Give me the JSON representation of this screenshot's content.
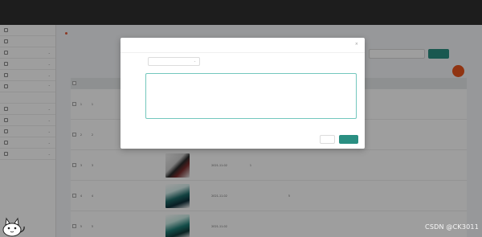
{
  "header": {
    "title": "",
    "user_links": [
      "",
      "",
      ""
    ]
  },
  "sidebar": {
    "items": [
      {
        "label": "",
        "expand": false
      },
      {
        "label": "",
        "expand": false
      },
      {
        "label": "",
        "expand": true
      },
      {
        "label": "",
        "expand": true
      },
      {
        "label": "",
        "expand": true
      },
      {
        "label": "",
        "expand": true
      },
      {
        "label": "",
        "expand": false,
        "sub": true
      },
      {
        "label": "",
        "expand": true
      },
      {
        "label": "",
        "expand": true
      },
      {
        "label": "",
        "expand": true
      },
      {
        "label": "",
        "expand": true
      },
      {
        "label": "",
        "expand": true
      }
    ]
  },
  "breadcrumb": {
    "home": "",
    "current": ""
  },
  "search": {
    "label": "",
    "placeholder": "",
    "button": ""
  },
  "table": {
    "headers": [
      "",
      "",
      "",
      "",
      "",
      "",
      "",
      "",
      "",
      "",
      "",
      "",
      "",
      "",
      ""
    ],
    "rows": [
      {
        "idx": "1",
        "no": "1",
        "c1": "",
        "c2": "",
        "c3": "",
        "thumb": "none",
        "date": "",
        "n1": "",
        "n2": "",
        "n3": "",
        "n4": "",
        "status": "",
        "review": "",
        "actions": [
          "",
          "",
          "",
          ""
        ]
      },
      {
        "idx": "2",
        "no": "2",
        "c1": "",
        "c2": "",
        "c3": "",
        "thumb": "none",
        "date": "",
        "n1": "",
        "n2": "",
        "n3": "",
        "n4": "",
        "status": "",
        "review": "",
        "actions": [
          "",
          "",
          "",
          ""
        ]
      },
      {
        "idx": "3",
        "no": "3",
        "c1": "",
        "c2": "",
        "c3": "",
        "thumb": "a",
        "date": "2021-11-02",
        "n1": "1",
        "n2": "",
        "n3": "",
        "n4": "",
        "status": "",
        "review": "",
        "actions": [
          "",
          "",
          "",
          ""
        ]
      },
      {
        "idx": "4",
        "no": "4",
        "c1": "",
        "c2": "",
        "c3": "",
        "thumb": "b",
        "date": "2021-11-02",
        "n1": "",
        "n2": "",
        "n3": "5",
        "n4": "",
        "status": "",
        "review": "",
        "actions": [
          "",
          "",
          "",
          ""
        ]
      },
      {
        "idx": "5",
        "no": "5",
        "c1": "",
        "c2": "",
        "c3": "",
        "thumb": "c",
        "date": "2021-11-02",
        "n1": "",
        "n2": "",
        "n3": "",
        "n4": "",
        "status": "",
        "review": "",
        "actions": [
          "",
          "",
          "",
          ""
        ]
      }
    ]
  },
  "modal": {
    "title": "",
    "status_label": "",
    "status_value": "",
    "reply_label": "",
    "reply_text": "",
    "cancel": "",
    "confirm": ""
  },
  "watermark": "CSDN @CK3011",
  "colors": {
    "accent": "#2a8f82",
    "topbar": "#2f2f2f",
    "danger": "#e8551d"
  }
}
